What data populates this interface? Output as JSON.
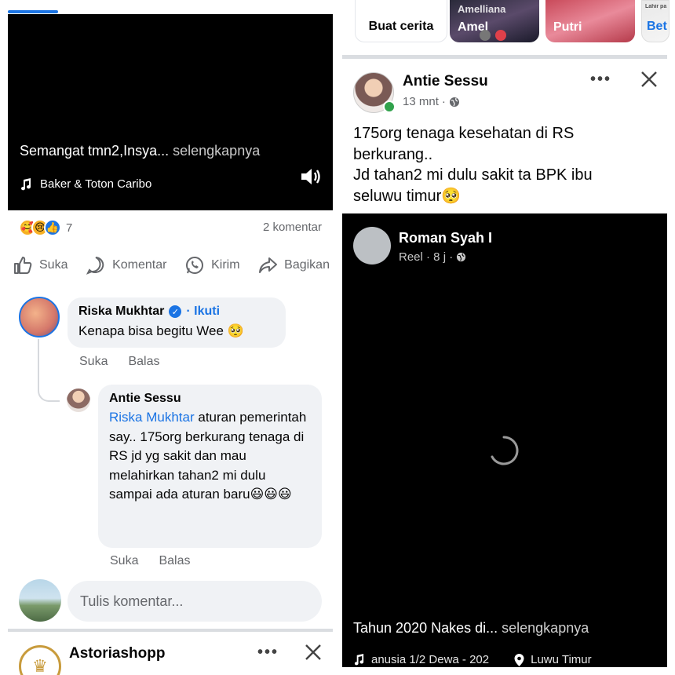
{
  "left": {
    "video": {
      "caption": "Semangat tmn2,Insya...",
      "caption_more": "selengkapnya",
      "music": "Baker & Toton Caribo"
    },
    "reactions": {
      "count": "7",
      "comments": "2 komentar"
    },
    "actions": {
      "like": "Suka",
      "comment": "Komentar",
      "send": "Kirim",
      "share": "Bagikan"
    },
    "comment1": {
      "author": "Riska Mukhtar",
      "follow": "Ikuti",
      "text": "Kenapa bisa begitu Wee 🥺",
      "like": "Suka",
      "reply": "Balas"
    },
    "comment2": {
      "author": "Antie Sessu",
      "mention": "Riska Mukhtar",
      "text": " aturan pemerintah say.. 175org berkurang tenaga di RS jd yg sakit dan mau melahirkan tahan2 mi dulu sampai ada aturan baru😃😃😃",
      "like": "Suka",
      "reply": "Balas"
    },
    "composer": {
      "placeholder": "Tulis komentar..."
    },
    "next_post": {
      "author": "Astoriashopp"
    }
  },
  "right": {
    "stories": {
      "create": "Buat cerita",
      "items": [
        {
          "top": "Amelliana",
          "label": "Amel"
        },
        {
          "label": "Putri"
        },
        {
          "top": "Lahir pa",
          "label": "Bet"
        }
      ]
    },
    "post": {
      "author": "Antie Sessu",
      "time": "13 mnt",
      "text_lines": [
        "175org tenaga kesehatan di RS",
        "berkurang..",
        "Jd tahan2 mi dulu sakit ta BPK ibu",
        "seluwu timur🥺"
      ]
    },
    "reel": {
      "author": "Roman Syah I",
      "meta": "Reel · 8 j ·",
      "caption": "Tahun 2020 Nakes di...",
      "caption_more": "selengkapnya",
      "music": "anusia 1/2 Dewa - 202",
      "location": "Luwu Timur"
    }
  },
  "colors": {
    "accent": "#1b74e4",
    "online": "#31a24c",
    "muted": "#65676b",
    "bubble": "#f0f2f5"
  }
}
